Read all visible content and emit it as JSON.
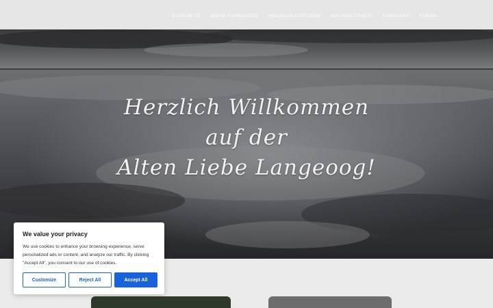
{
  "nav": {
    "items": [
      {
        "label": "STARTSEITE"
      },
      {
        "label": "MEINE FÜHRUNGEN"
      },
      {
        "label": "WOCHAUS ALTE LIEBE"
      },
      {
        "label": "NACHHALTIGKEIT"
      },
      {
        "label": "EHRENAMT"
      },
      {
        "label": "FORUM"
      }
    ]
  },
  "hero": {
    "line1": "Herzlich Willkommen",
    "line2": "auf der",
    "line3": "Alten Liebe Langeoog!"
  },
  "cookie": {
    "title": "We value your privacy",
    "text": "We use cookies to enhance your browsing experience, serve personalized ads or content, and analyze our traffic. By clicking \"Accept All\", you consent to our use of cookies.",
    "customize_label": "Customize",
    "reject_label": "Reject All",
    "accept_label": "Accept All",
    "accent_color": "#1863dc"
  }
}
